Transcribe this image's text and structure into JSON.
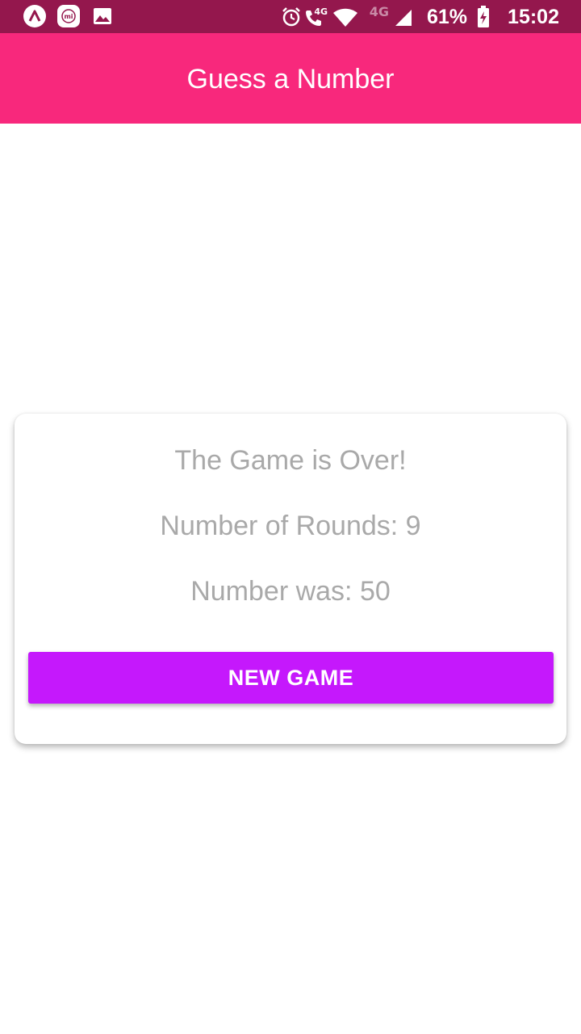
{
  "status_bar": {
    "battery_percent_label": "61%",
    "time": "15:02",
    "network_label_call": "4G",
    "network_label_signal": "4G",
    "icons": [
      "app-logo-icon",
      "mi-app-icon",
      "gallery-icon",
      "alarm-icon",
      "volte-call-icon",
      "wifi-icon",
      "cell-signal-icon",
      "battery-charging-icon"
    ],
    "background_color": "#94174d"
  },
  "header": {
    "title": "Guess a Number",
    "background_color": "#f8287c"
  },
  "game_over_card": {
    "heading": "The Game is Over!",
    "rounds_text": "Number of Rounds: 9",
    "number_text": "Number was: 50",
    "new_game_label": "NEW GAME",
    "button_color": "#c518fc",
    "text_color": "#a9a9a9"
  }
}
